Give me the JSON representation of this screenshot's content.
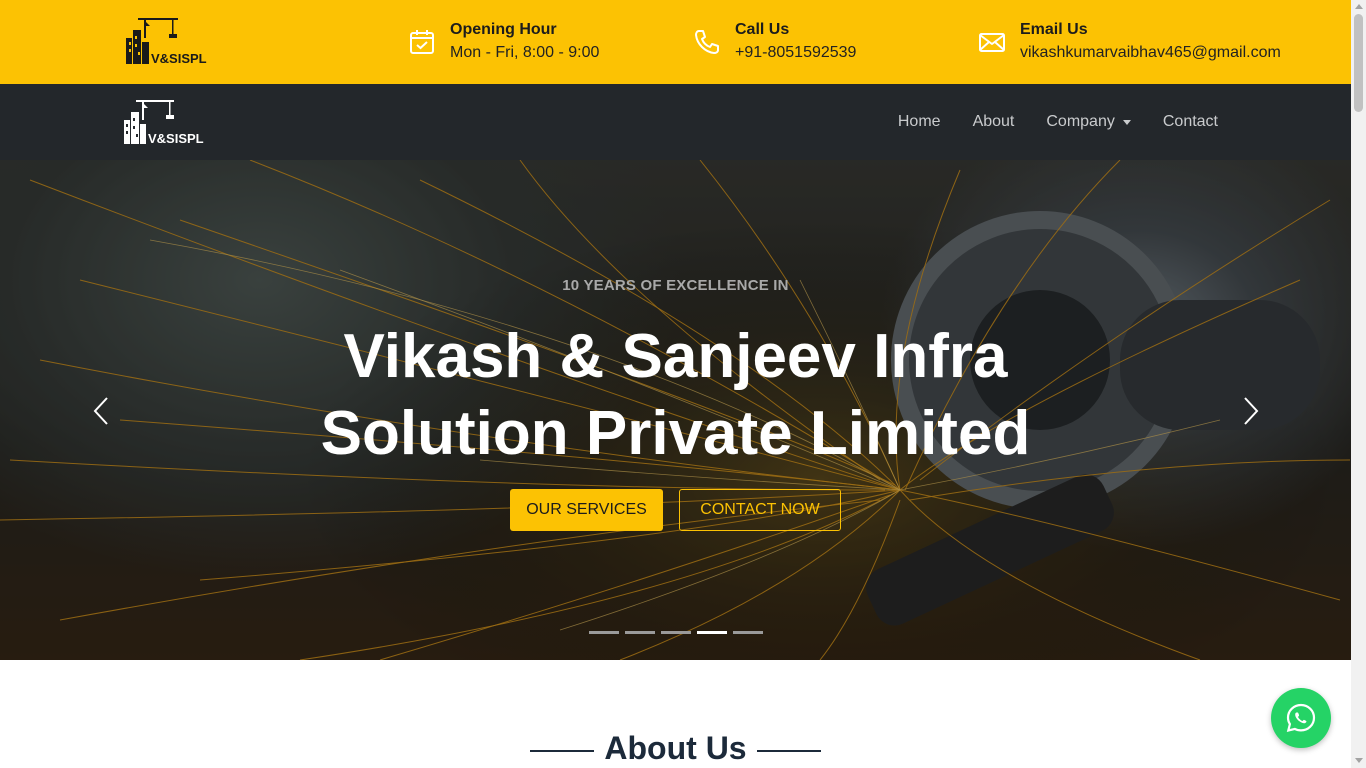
{
  "topbar": {
    "logo_text": "V&SISPL",
    "opening": {
      "title": "Opening Hour",
      "value": "Mon - Fri, 8:00 - 9:00",
      "icon": "calendar-icon"
    },
    "call": {
      "title": "Call Us",
      "value": "+91-8051592539",
      "icon": "phone-icon"
    },
    "email": {
      "title": "Email Us",
      "value": "vikashkumarvaibhav465@gmail.com",
      "icon": "envelope-icon"
    }
  },
  "navbar": {
    "logo_text": "V&SISPL",
    "links": [
      "Home",
      "About",
      "Company",
      "Contact"
    ]
  },
  "hero": {
    "subtitle": "10 YEARS OF EXCELLENCE IN",
    "title_line1": "Vikash & Sanjeev Infra",
    "title_line2": "Solution Private Limited",
    "btn_services": "OUR SERVICES",
    "btn_contact": "CONTACT NOW",
    "slide_count": 5,
    "active_slide": 4
  },
  "about": {
    "heading": "About Us"
  },
  "colors": {
    "accent": "#fcc203",
    "nav_bg": "#23272b",
    "whatsapp": "#25d366"
  }
}
